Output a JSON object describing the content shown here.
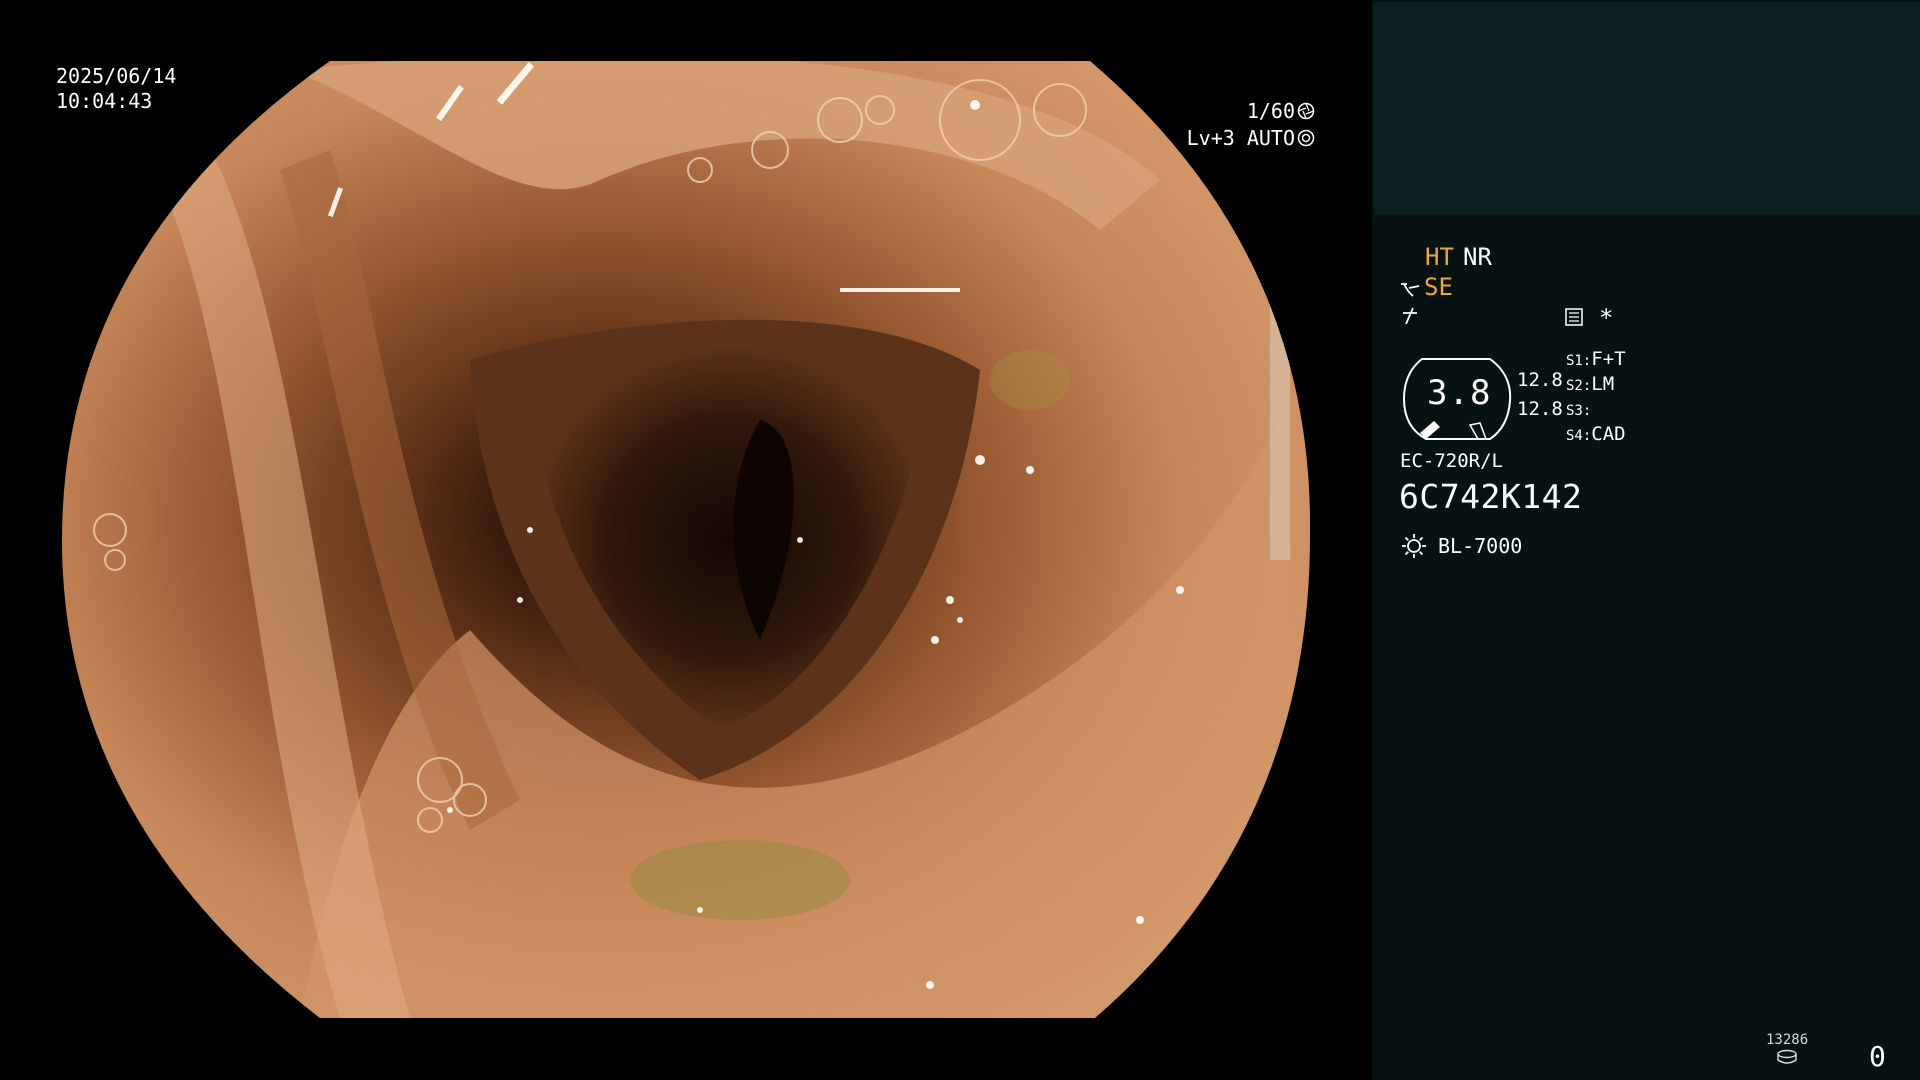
{
  "overlay": {
    "date": "2025/06/14",
    "time": "10:04:43",
    "shutter": "1/60",
    "iris": "Lv+3 AUTO"
  },
  "panel": {
    "ht": "HT",
    "nr": "NR",
    "se": "SE",
    "star": "*",
    "gauge_value": "3.8",
    "pressure_1": "12.8",
    "pressure_2": "12.8",
    "switches": [
      {
        "key": "S1:",
        "value": "F+T"
      },
      {
        "key": "S2:",
        "value": "LM"
      },
      {
        "key": "S3:",
        "value": ""
      },
      {
        "key": "S4:",
        "value": "CAD"
      }
    ],
    "scope_model": "EC-720R/L",
    "serial": "6C742K142",
    "light_source": "BL-7000",
    "disk_count": "13286",
    "image_counter": "0"
  },
  "icons": {
    "shutter": "aperture-icon",
    "iris": "iris-icon",
    "se": "scope-tip-icon",
    "enhance": "enhancement-icon",
    "document": "document-icon",
    "light": "light-source-icon",
    "disk": "storage-disk-icon"
  },
  "colors": {
    "panel_bg": "#071212",
    "panel_top": "#0b1f21",
    "accent_orange": "#f3a632",
    "mucosa": "#c9885a"
  }
}
